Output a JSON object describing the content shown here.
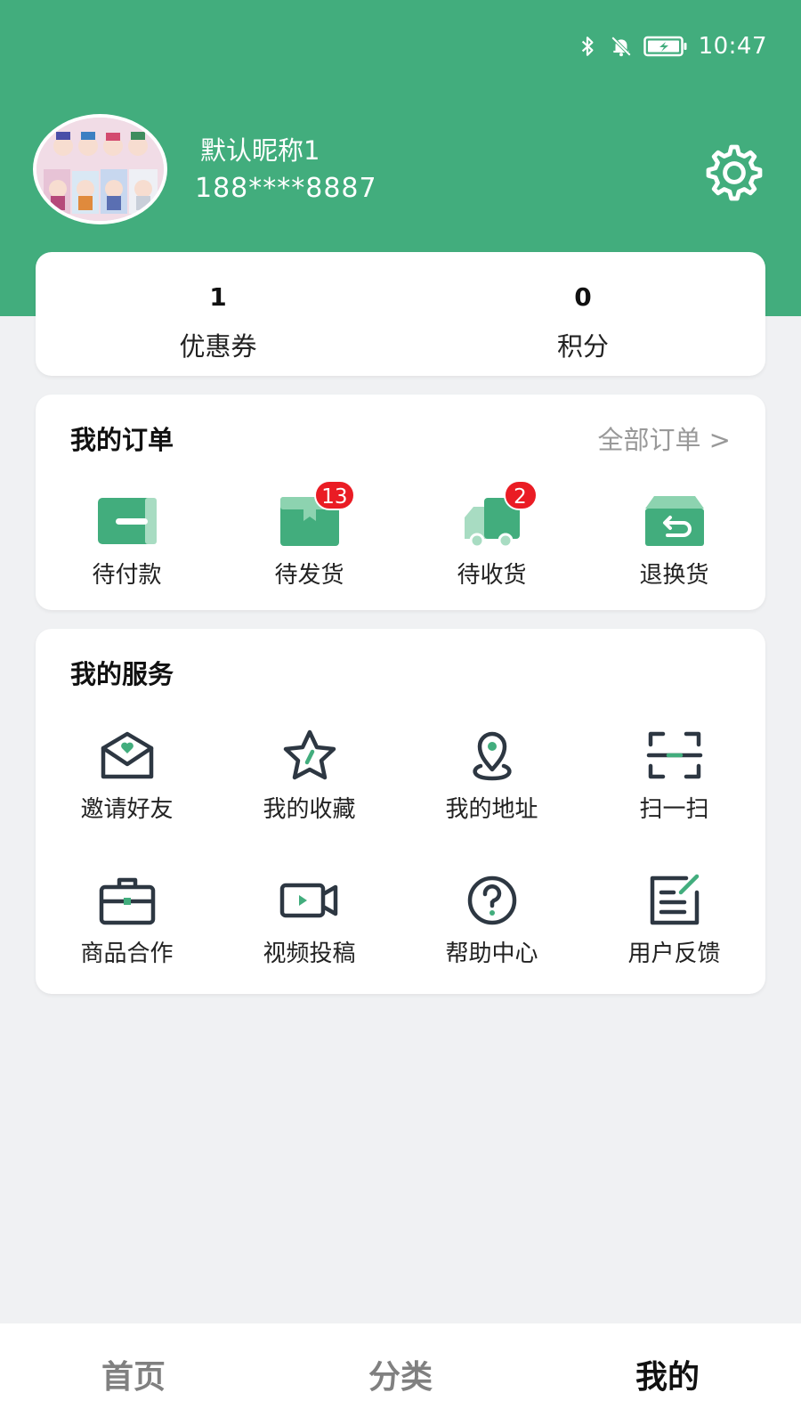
{
  "status_bar": {
    "time": "10:47",
    "icons": [
      "bluetooth-icon",
      "bell-muted-icon",
      "battery-charging-icon"
    ]
  },
  "profile": {
    "nickname": "默认昵称1",
    "phone": "188****8887",
    "settings_icon": "gear-icon"
  },
  "stats": [
    {
      "value": "1",
      "label": "优惠券"
    },
    {
      "value": "0",
      "label": "积分"
    }
  ],
  "orders": {
    "title": "我的订单",
    "all_link": "全部订单 >",
    "items": [
      {
        "label": "待付款",
        "icon": "wallet-icon",
        "badge": null
      },
      {
        "label": "待发货",
        "icon": "package-icon",
        "badge": "13"
      },
      {
        "label": "待收货",
        "icon": "truck-icon",
        "badge": "2"
      },
      {
        "label": "退换货",
        "icon": "return-box-icon",
        "badge": null
      }
    ]
  },
  "services": {
    "title": "我的服务",
    "items": [
      {
        "label": "邀请好友",
        "icon": "envelope-heart-icon"
      },
      {
        "label": "我的收藏",
        "icon": "star-icon"
      },
      {
        "label": "我的地址",
        "icon": "location-pin-icon"
      },
      {
        "label": "扫一扫",
        "icon": "scan-icon"
      },
      {
        "label": "商品合作",
        "icon": "briefcase-icon"
      },
      {
        "label": "视频投稿",
        "icon": "video-camera-icon"
      },
      {
        "label": "帮助中心",
        "icon": "help-circle-icon"
      },
      {
        "label": "用户反馈",
        "icon": "feedback-edit-icon"
      }
    ]
  },
  "tabbar": {
    "items": [
      {
        "label": "首页",
        "active": false
      },
      {
        "label": "分类",
        "active": false
      },
      {
        "label": "我的",
        "active": true
      }
    ]
  },
  "colors": {
    "primary": "#42ad7d",
    "icon_dark": "#2d3742",
    "badge": "#ea1c24",
    "background": "#f0f1f3"
  }
}
